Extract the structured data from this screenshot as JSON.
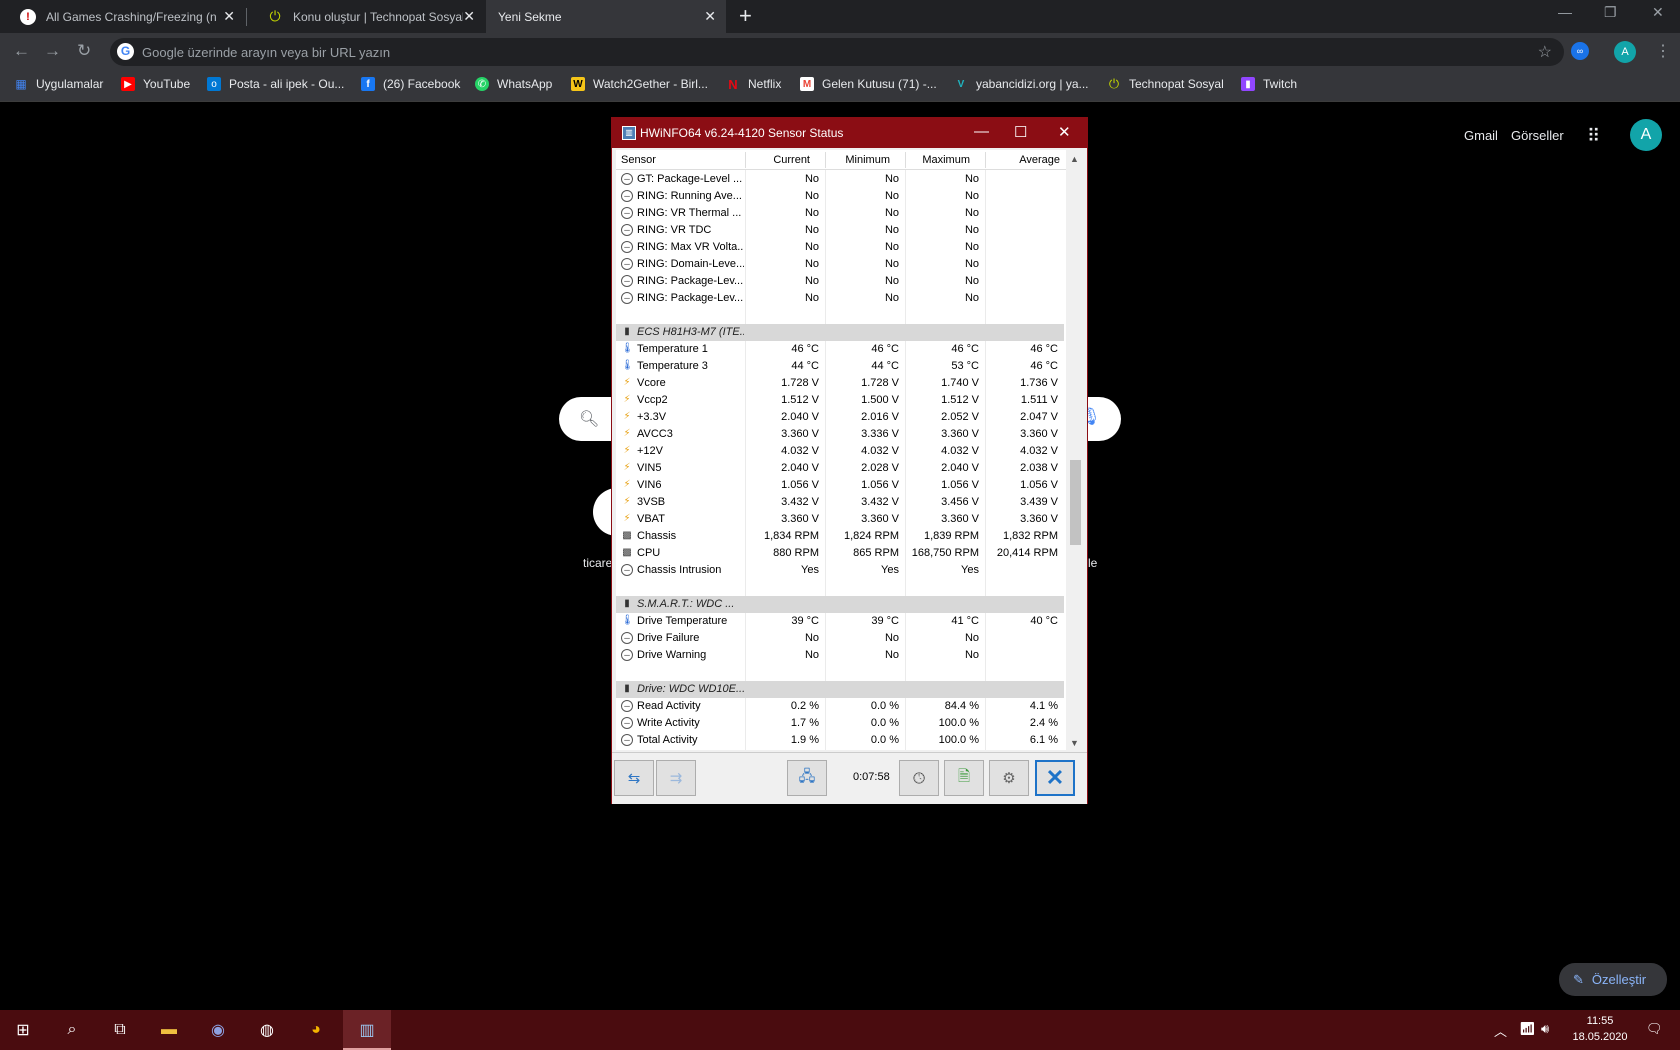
{
  "browser": {
    "tabs": [
      {
        "title": "All Games Crashing/Freezing (no",
        "icon": "tomshardware-icon"
      },
      {
        "title": "Konu oluştur | Technopat Sosyal",
        "icon": "power-icon"
      },
      {
        "title": "Yeni Sekme",
        "icon": ""
      }
    ],
    "new_tab": "+",
    "address_placeholder": "Google üzerinde arayın veya bir URL yazın",
    "profile_initial": "A",
    "bookmarks": [
      {
        "label": "Uygulamalar",
        "icon": "apps-icon",
        "color": "#4285f4"
      },
      {
        "label": "YouTube",
        "icon": "youtube-icon",
        "color": "#ff0000"
      },
      {
        "label": "Posta - ali ipek - Ou...",
        "icon": "outlook-icon",
        "color": "#0078d4"
      },
      {
        "label": "(26) Facebook",
        "icon": "facebook-icon",
        "color": "#1877f2"
      },
      {
        "label": "WhatsApp",
        "icon": "whatsapp-icon",
        "color": "#25d366"
      },
      {
        "label": "Watch2Gether - Birl...",
        "icon": "watch2gether-icon",
        "color": "#f5c518"
      },
      {
        "label": "Netflix",
        "icon": "netflix-icon",
        "color": "#e50914"
      },
      {
        "label": "Gelen Kutusu (71) -...",
        "icon": "gmail-icon",
        "color": "#ea4335"
      },
      {
        "label": "yabancidizi.org | ya...",
        "icon": "yabancidizi-icon",
        "color": "#1fb6c1"
      },
      {
        "label": "Technopat Sosyal",
        "icon": "power-icon",
        "color": "#c4d600"
      },
      {
        "label": "Twitch",
        "icon": "twitch-icon",
        "color": "#9146ff"
      }
    ]
  },
  "ntp": {
    "gmail": "Gmail",
    "images": "Görseller",
    "avatar": "A",
    "shortcut_left": "ticare",
    "shortcut_right": "le",
    "customize": "Özelleştir"
  },
  "hwinfo": {
    "title": "HWiNFO64 v6.24-4120 Sensor Status",
    "columns": [
      "Sensor",
      "Current",
      "Minimum",
      "Maximum",
      "Average"
    ],
    "rows": [
      {
        "type": "circle",
        "name": "GT: Package-Level ...",
        "cur": "No",
        "min": "No",
        "max": "No",
        "avg": ""
      },
      {
        "type": "circle",
        "name": "RING: Running Ave...",
        "cur": "No",
        "min": "No",
        "max": "No",
        "avg": ""
      },
      {
        "type": "circle",
        "name": "RING: VR Thermal ...",
        "cur": "No",
        "min": "No",
        "max": "No",
        "avg": ""
      },
      {
        "type": "circle",
        "name": "RING: VR TDC",
        "cur": "No",
        "min": "No",
        "max": "No",
        "avg": ""
      },
      {
        "type": "circle",
        "name": "RING: Max VR Volta...",
        "cur": "No",
        "min": "No",
        "max": "No",
        "avg": ""
      },
      {
        "type": "circle",
        "name": "RING: Domain-Leve...",
        "cur": "No",
        "min": "No",
        "max": "No",
        "avg": ""
      },
      {
        "type": "circle",
        "name": "RING: Package-Lev...",
        "cur": "No",
        "min": "No",
        "max": "No",
        "avg": ""
      },
      {
        "type": "circle",
        "name": "RING: Package-Lev...",
        "cur": "No",
        "min": "No",
        "max": "No",
        "avg": ""
      },
      {
        "type": "blank",
        "name": "",
        "cur": "",
        "min": "",
        "max": "",
        "avg": ""
      },
      {
        "type": "group",
        "name": "ECS H81H3-M7 (ITE...",
        "cur": "",
        "min": "",
        "max": "",
        "avg": ""
      },
      {
        "type": "therm",
        "name": "Temperature 1",
        "cur": "46 °C",
        "min": "46 °C",
        "max": "46 °C",
        "avg": "46 °C"
      },
      {
        "type": "therm",
        "name": "Temperature 3",
        "cur": "44 °C",
        "min": "44 °C",
        "max": "53 °C",
        "avg": "46 °C"
      },
      {
        "type": "volt",
        "name": "Vcore",
        "cur": "1.728 V",
        "min": "1.728 V",
        "max": "1.740 V",
        "avg": "1.736 V"
      },
      {
        "type": "volt",
        "name": "Vccp2",
        "cur": "1.512 V",
        "min": "1.500 V",
        "max": "1.512 V",
        "avg": "1.511 V"
      },
      {
        "type": "volt",
        "name": "+3.3V",
        "cur": "2.040 V",
        "min": "2.016 V",
        "max": "2.052 V",
        "avg": "2.047 V"
      },
      {
        "type": "volt",
        "name": "AVCC3",
        "cur": "3.360 V",
        "min": "3.336 V",
        "max": "3.360 V",
        "avg": "3.360 V"
      },
      {
        "type": "volt",
        "name": "+12V",
        "cur": "4.032 V",
        "min": "4.032 V",
        "max": "4.032 V",
        "avg": "4.032 V"
      },
      {
        "type": "volt",
        "name": "VIN5",
        "cur": "2.040 V",
        "min": "2.028 V",
        "max": "2.040 V",
        "avg": "2.038 V"
      },
      {
        "type": "volt",
        "name": "VIN6",
        "cur": "1.056 V",
        "min": "1.056 V",
        "max": "1.056 V",
        "avg": "1.056 V"
      },
      {
        "type": "volt",
        "name": "3VSB",
        "cur": "3.432 V",
        "min": "3.432 V",
        "max": "3.456 V",
        "avg": "3.439 V"
      },
      {
        "type": "volt",
        "name": "VBAT",
        "cur": "3.360 V",
        "min": "3.360 V",
        "max": "3.360 V",
        "avg": "3.360 V"
      },
      {
        "type": "fan",
        "name": "Chassis",
        "cur": "1,834 RPM",
        "min": "1,824 RPM",
        "max": "1,839 RPM",
        "avg": "1,832 RPM"
      },
      {
        "type": "fan",
        "name": "CPU",
        "cur": "880 RPM",
        "min": "865 RPM",
        "max": "168,750 RPM",
        "avg": "20,414 RPM"
      },
      {
        "type": "circle",
        "name": "Chassis Intrusion",
        "cur": "Yes",
        "min": "Yes",
        "max": "Yes",
        "avg": ""
      },
      {
        "type": "blank",
        "name": "",
        "cur": "",
        "min": "",
        "max": "",
        "avg": ""
      },
      {
        "type": "group",
        "name": "S.M.A.R.T.: WDC ...",
        "cur": "",
        "min": "",
        "max": "",
        "avg": ""
      },
      {
        "type": "therm",
        "name": "Drive Temperature",
        "cur": "39 °C",
        "min": "39 °C",
        "max": "41 °C",
        "avg": "40 °C"
      },
      {
        "type": "circle",
        "name": "Drive Failure",
        "cur": "No",
        "min": "No",
        "max": "No",
        "avg": ""
      },
      {
        "type": "circle",
        "name": "Drive Warning",
        "cur": "No",
        "min": "No",
        "max": "No",
        "avg": ""
      },
      {
        "type": "blank",
        "name": "",
        "cur": "",
        "min": "",
        "max": "",
        "avg": ""
      },
      {
        "type": "group",
        "name": "Drive: WDC WD10E...",
        "cur": "",
        "min": "",
        "max": "",
        "avg": ""
      },
      {
        "type": "circle",
        "name": "Read Activity",
        "cur": "0.2 %",
        "min": "0.0 %",
        "max": "84.4 %",
        "avg": "4.1 %"
      },
      {
        "type": "circle",
        "name": "Write Activity",
        "cur": "1.7 %",
        "min": "0.0 %",
        "max": "100.0 %",
        "avg": "2.4 %"
      },
      {
        "type": "circle",
        "name": "Total Activity",
        "cur": "1.9 %",
        "min": "0.0 %",
        "max": "100.0 %",
        "avg": "6.1 %"
      }
    ],
    "timer": "0:07:58"
  },
  "taskbar": {
    "time": "11:55",
    "date": "18.05.2020"
  },
  "colors": {
    "hwinfo_title": "#8b0d14",
    "taskbar": "#4a0c0f",
    "chrome_dark": "#35363a"
  }
}
